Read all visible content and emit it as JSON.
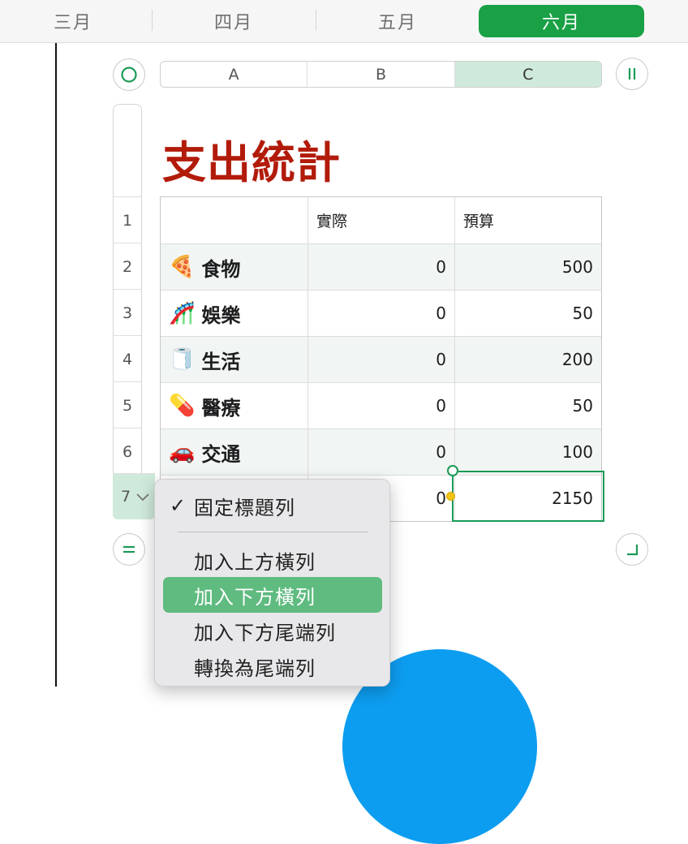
{
  "tabs": [
    {
      "label": "三月",
      "active": false
    },
    {
      "label": "四月",
      "active": false
    },
    {
      "label": "五月",
      "active": false
    },
    {
      "label": "六月",
      "active": true
    }
  ],
  "columns": [
    "A",
    "B",
    "C"
  ],
  "row_numbers": [
    "1",
    "2",
    "3",
    "4",
    "5",
    "6",
    "7"
  ],
  "sheet_title": "支出統計",
  "table": {
    "headers": [
      "",
      "實際",
      "預算"
    ],
    "rows": [
      {
        "emoji": "🍕",
        "category": "食物",
        "actual": "0",
        "budget": "500"
      },
      {
        "emoji": "🎢",
        "category": "娛樂",
        "actual": "0",
        "budget": "50"
      },
      {
        "emoji": "🧻",
        "category": "生活",
        "actual": "0",
        "budget": "200"
      },
      {
        "emoji": "💊",
        "category": "醫療",
        "actual": "0",
        "budget": "50"
      },
      {
        "emoji": "🚗",
        "category": "交通",
        "actual": "0",
        "budget": "100"
      },
      {
        "emoji": "",
        "category": "",
        "actual": "0",
        "budget": "2150"
      }
    ]
  },
  "context_menu": {
    "items": [
      {
        "label": "固定標題列",
        "checked": true
      },
      {
        "label": "加入上方橫列",
        "checked": false
      },
      {
        "label": "加入下方橫列",
        "checked": false,
        "highlighted": true
      },
      {
        "label": "加入下方尾端列",
        "checked": false
      },
      {
        "label": "轉換為尾端列",
        "checked": false
      }
    ],
    "check_glyph": "✓"
  },
  "colors": {
    "accent": "#1aa146",
    "title": "#b21b0a",
    "selection": "#1a9a57",
    "menu_highlight": "#5fbb7f",
    "chart_blue": "#0d9df0"
  }
}
